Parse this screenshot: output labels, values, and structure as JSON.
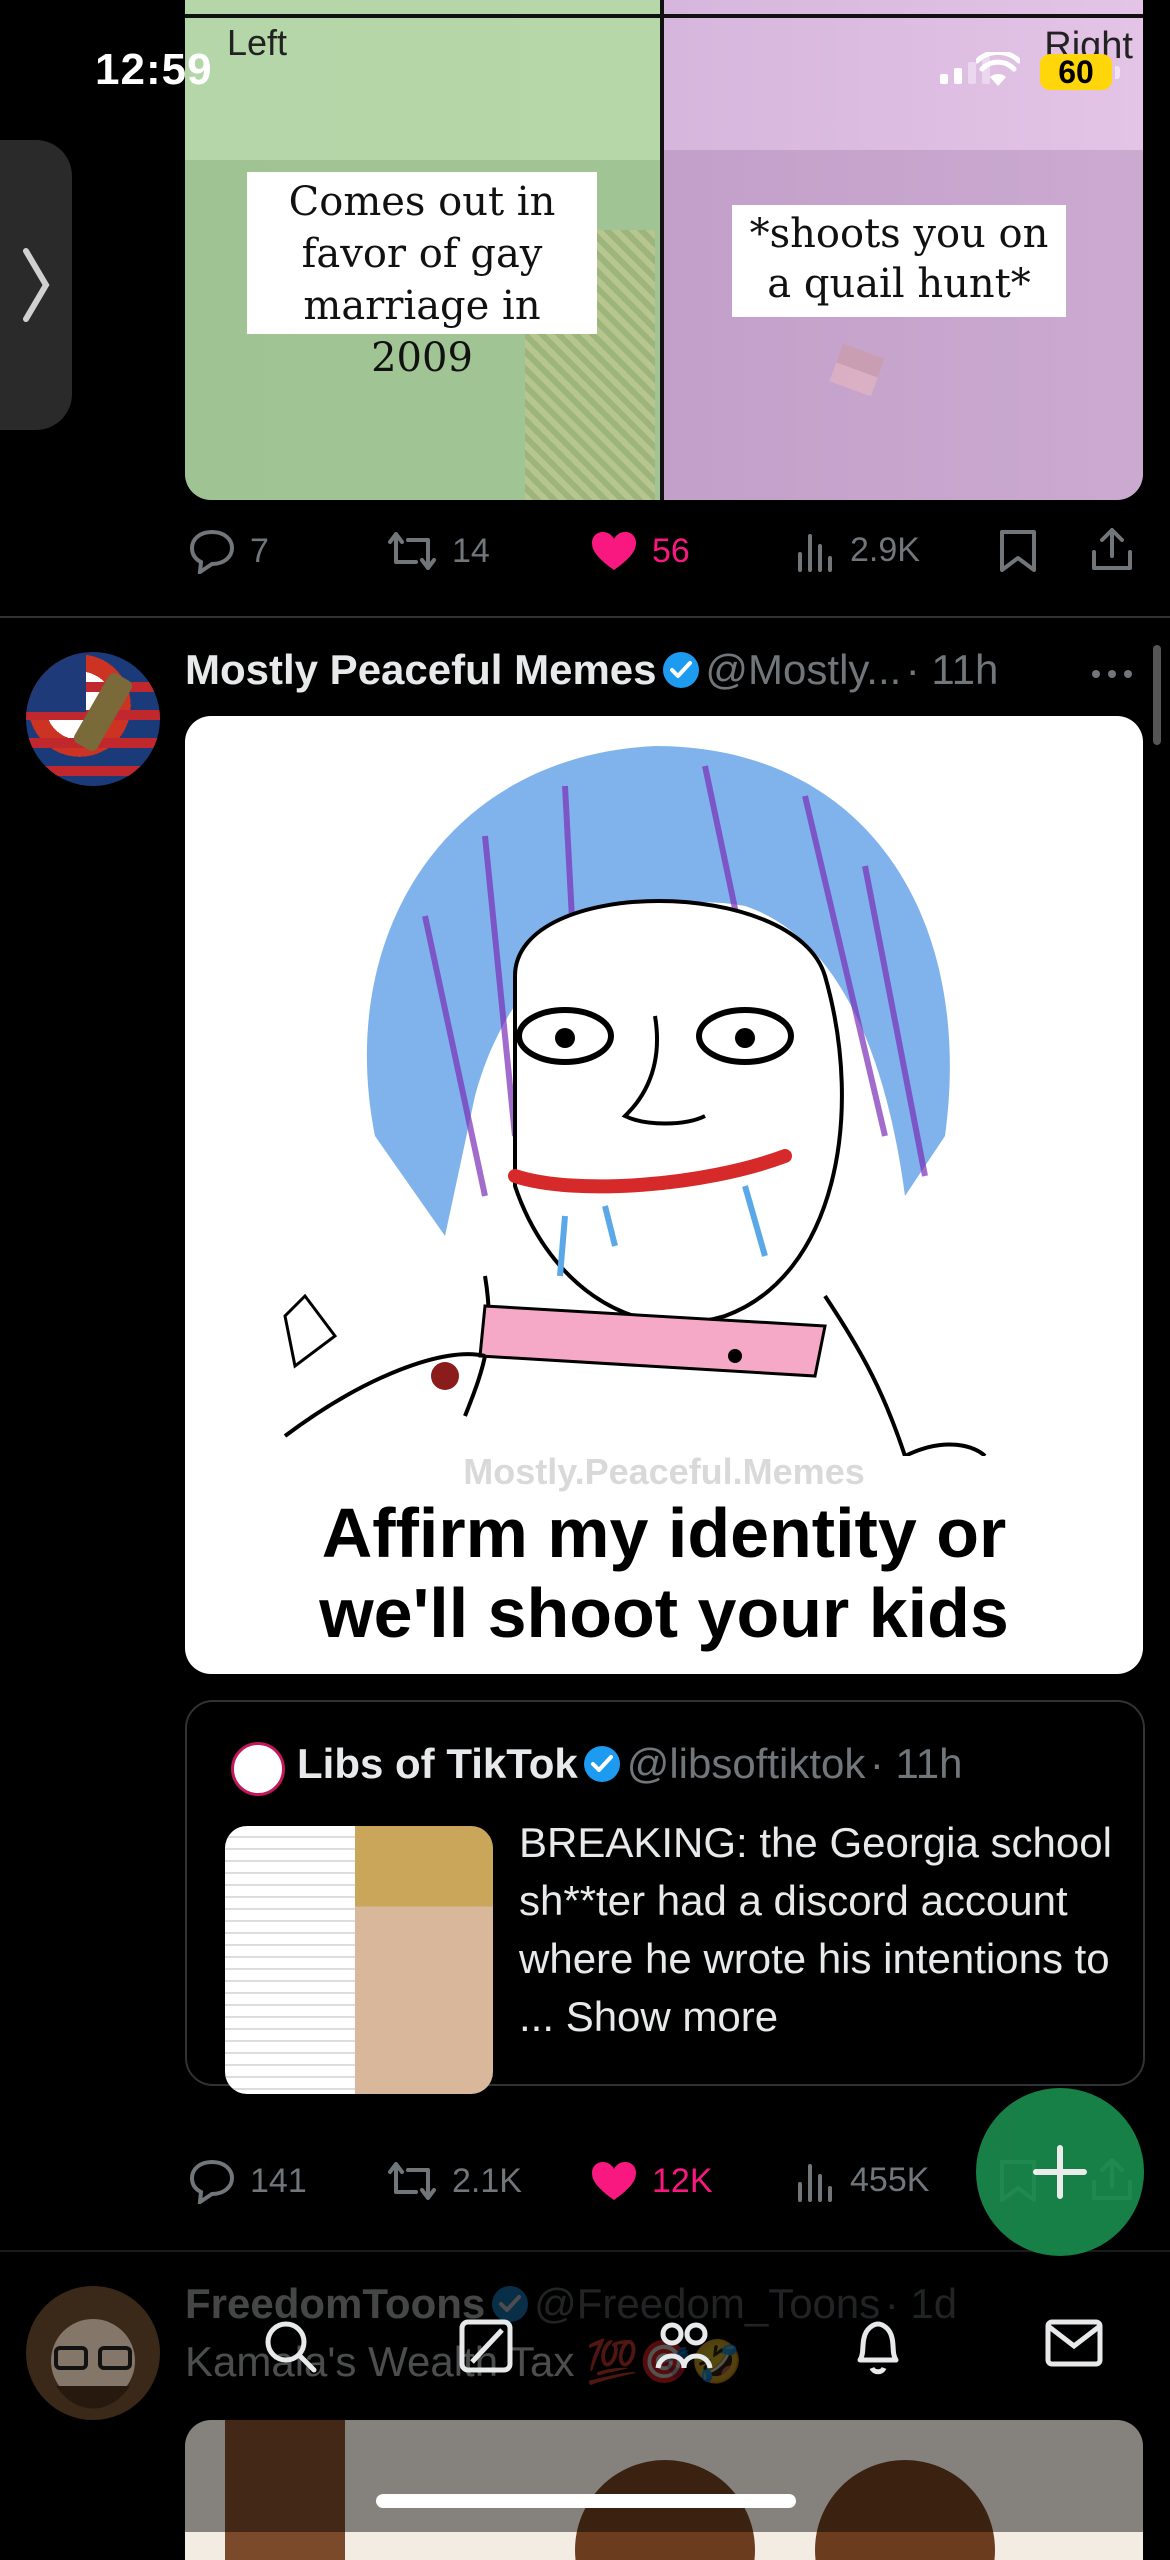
{
  "status_bar": {
    "time": "12:59",
    "battery": "60"
  },
  "top_post": {
    "axis_left": "Left",
    "axis_right": "Right",
    "label_left": "Comes out in favor of gay marriage in 2009",
    "label_right": "*shoots you on a quail hunt*",
    "replies": "7",
    "reposts": "14",
    "likes": "56",
    "views": "2.9K"
  },
  "post": {
    "display_name": "Mostly Peaceful Memes",
    "handle": "@Mostly...",
    "time": "· 11h",
    "meme_watermark": "Mostly.Peaceful.Memes",
    "meme_caption_line1": "Affirm my identity or",
    "meme_caption_line2": "we'll shoot your kids",
    "quote": {
      "display_name": "Libs of TikTok",
      "handle": "@libsoftiktok",
      "time": "· 11h",
      "text": "BREAKING: the Georgia school sh**ter had a discord account where he wrote his intentions to ...",
      "show_more": "Show more"
    },
    "replies": "141",
    "reposts": "2.1K",
    "likes": "12K",
    "views": "455K"
  },
  "next_post": {
    "display_name": "FreedomToons",
    "handle": "@Freedom_Toons",
    "time": "· 1d",
    "text": "Kamala's Wealth Tax 💯🎯🤣"
  },
  "colors": {
    "like": "#f91880",
    "verified": "#1d9bf0",
    "fab": "#1a8b4c"
  }
}
